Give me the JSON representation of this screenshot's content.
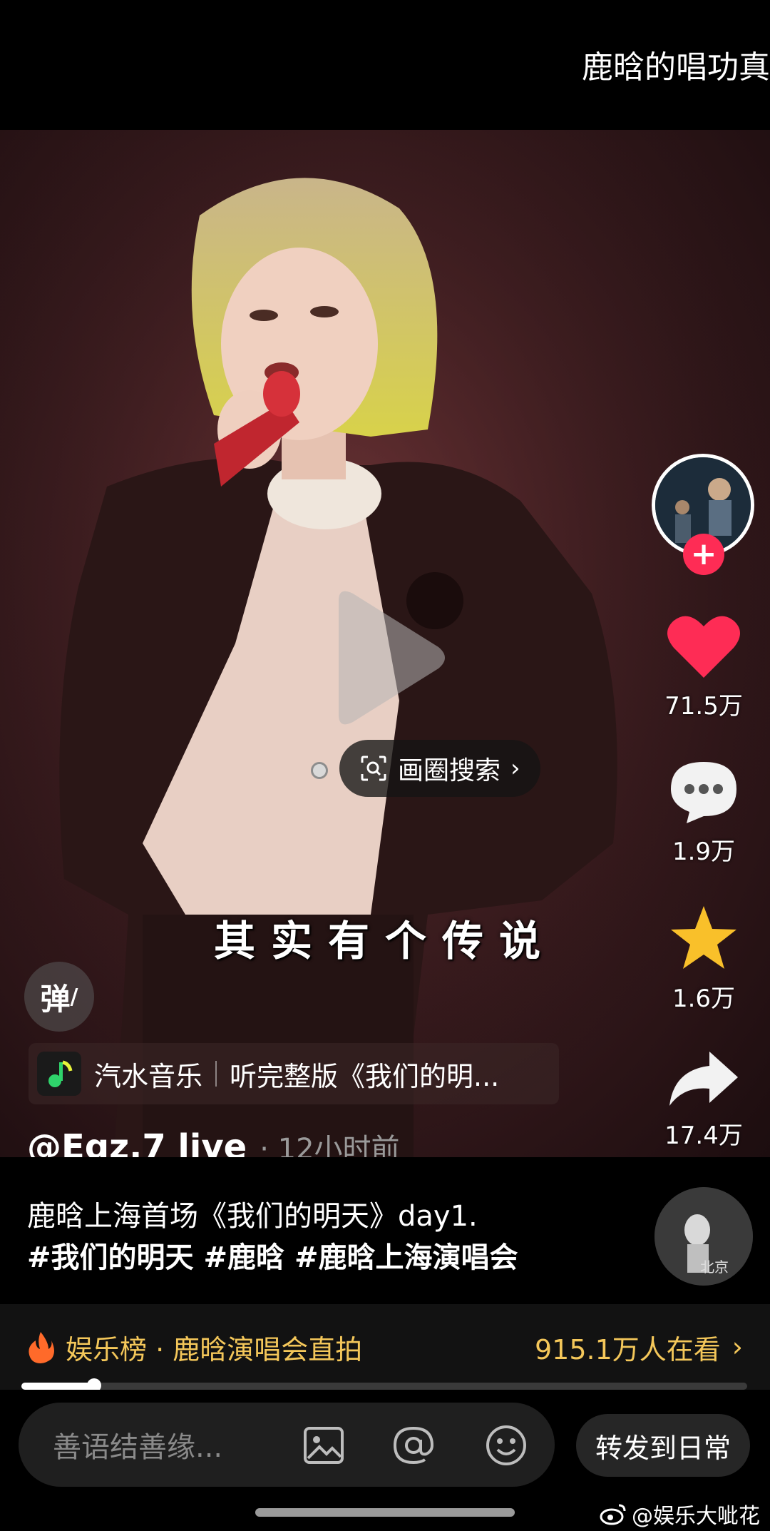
{
  "header": {
    "title": "鹿晗的唱功真"
  },
  "video": {
    "subtitle": "其实有个传说",
    "circle_search_label": "画圈搜索",
    "danmu_label": "弹",
    "music": {
      "app": "汽水音乐",
      "cta": "听完整版《我们的明..."
    }
  },
  "side_actions": {
    "likes": "71.5万",
    "comments": "1.9万",
    "favorites": "1.6万",
    "shares": "17.4万"
  },
  "post": {
    "author": "@Egz.7 live",
    "time": "· 12小时前",
    "caption": "鹿晗上海首场《我们的明天》day1.",
    "tags": [
      "#我们的明天",
      "#鹿晗",
      "#鹿晗上海演唱会"
    ],
    "thumb_text": "北京"
  },
  "ranking": {
    "left": "娱乐榜 · 鹿晗演唱会直拍",
    "right": "915.1万人在看"
  },
  "playback": {
    "progress": 0.1
  },
  "bottom_bar": {
    "input_placeholder": "善语结善缘...",
    "forward_label": "转发到日常"
  },
  "watermark": "@娱乐大呲花",
  "colors": {
    "like": "#fe2c55",
    "favorite": "#f9c02a",
    "rank": "#f4c75a"
  }
}
